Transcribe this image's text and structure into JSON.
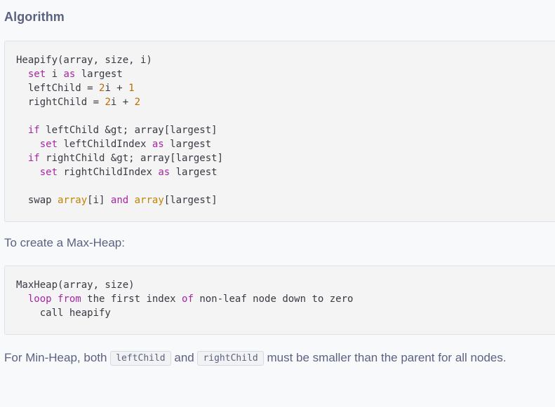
{
  "heading": "Algorithm",
  "code1": {
    "l1": {
      "a": "Heapify(array, size, i)"
    },
    "l2": {
      "ind": "  ",
      "kw1": "set",
      "t1": " i ",
      "kw2": "as",
      "t2": " largest"
    },
    "l3": {
      "t1": "  leftChild = ",
      "n1": "2",
      "t2": "i + ",
      "n2": "1"
    },
    "l4": {
      "t1": "  rightChild = ",
      "n1": "2",
      "t2": "i + ",
      "n2": "2"
    },
    "l6": {
      "ind": "  ",
      "kw1": "if",
      "t1": " leftChild &gt; array[largest]"
    },
    "l7": {
      "ind": "    ",
      "kw1": "set",
      "t1": " leftChildIndex ",
      "kw2": "as",
      "t2": " largest"
    },
    "l8": {
      "ind": "  ",
      "kw1": "if",
      "t1": " rightChild &gt; array[largest]"
    },
    "l9": {
      "ind": "    ",
      "kw1": "set",
      "t1": " rightChildIndex ",
      "kw2": "as",
      "t2": " largest"
    },
    "l11": {
      "t1": "  swap ",
      "b1": "array",
      "t2": "[i] ",
      "kw1": "and",
      "t3": " ",
      "b2": "array",
      "t4": "[largest]"
    }
  },
  "para1": "To create a Max-Heap:",
  "code2": {
    "l1": {
      "a": "MaxHeap(array, size)"
    },
    "l2": {
      "ind": "  ",
      "kw1": "loop",
      "t1": " ",
      "kw2": "from",
      "t2": " the first index ",
      "kw3": "of",
      "t3": " non-leaf node down to zero"
    },
    "l3": {
      "a": "    call heapify"
    }
  },
  "para2": {
    "t1": "For Min-Heap, both ",
    "c1": "leftChild",
    "t2": " and ",
    "c2": "rightChild",
    "t3": " must be smaller than the parent for all nodes."
  },
  "colors": {
    "keyword": "#a626a4",
    "number": "#b76b01",
    "builtin": "#c18401",
    "text": "#5b6280"
  }
}
